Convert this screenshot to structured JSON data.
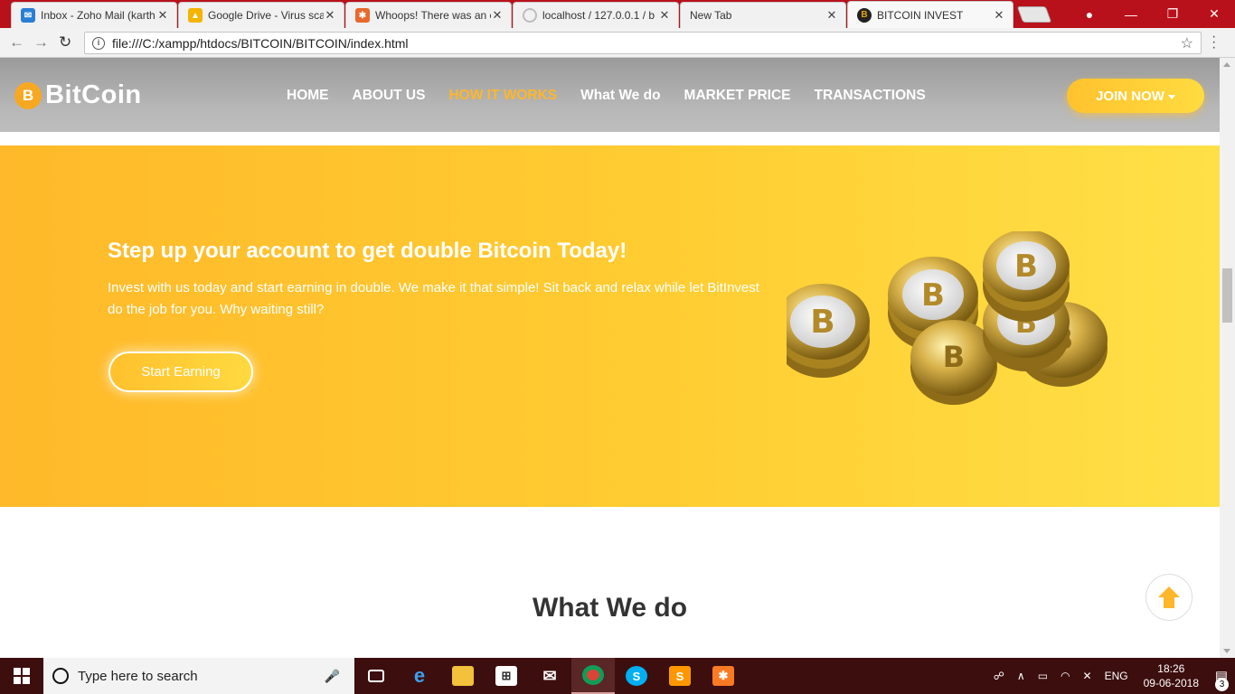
{
  "browser": {
    "tabs": [
      {
        "title": "Inbox - Zoho Mail (karth",
        "favicon_color": "#2a7fd4"
      },
      {
        "title": "Google Drive - Virus sca",
        "favicon_color": "#f4b400"
      },
      {
        "title": "Whoops! There was an e",
        "favicon_color": "#e8692b"
      },
      {
        "title": "localhost / 127.0.0.1 / b",
        "favicon_color": "#bdbdbd"
      },
      {
        "title": "New Tab",
        "favicon_color": "#f1f1f1"
      },
      {
        "title": "BITCOIN INVEST",
        "favicon_color": "#e3a400"
      }
    ],
    "active_tab": 5,
    "url": "file:///C:/xampp/htdocs/BITCOIN/BITCOIN/index.html"
  },
  "site": {
    "logo_text": "BitCoin",
    "logo_symbol": "B",
    "nav": [
      "HOME",
      "ABOUT US",
      "HOW IT WORKS",
      "What We do",
      "MARKET PRICE",
      "TRANSACTIONS"
    ],
    "nav_active": "HOW IT WORKS",
    "join_label": "JOIN NOW",
    "hero": {
      "title": "Step up your account to get double Bitcoin Today!",
      "text": "Invest with us today and start earning in double. We make it that simple! Sit back and relax while let BitInvest do the job for you. Why waiting still?",
      "button": "Start Earning"
    },
    "section_title": "What We do",
    "colors": {
      "accent": "#ffb62a",
      "hero_start": "#ffb92a",
      "hero_end": "#ffe047"
    }
  },
  "taskbar": {
    "search_placeholder": "Type here to search",
    "language": "ENG",
    "time": "18:26",
    "date": "09-06-2018",
    "notifications": "3",
    "apps": [
      "task-view",
      "edge",
      "file-explorer",
      "store",
      "mail",
      "chrome",
      "skype",
      "sublime-text",
      "xampp"
    ]
  }
}
